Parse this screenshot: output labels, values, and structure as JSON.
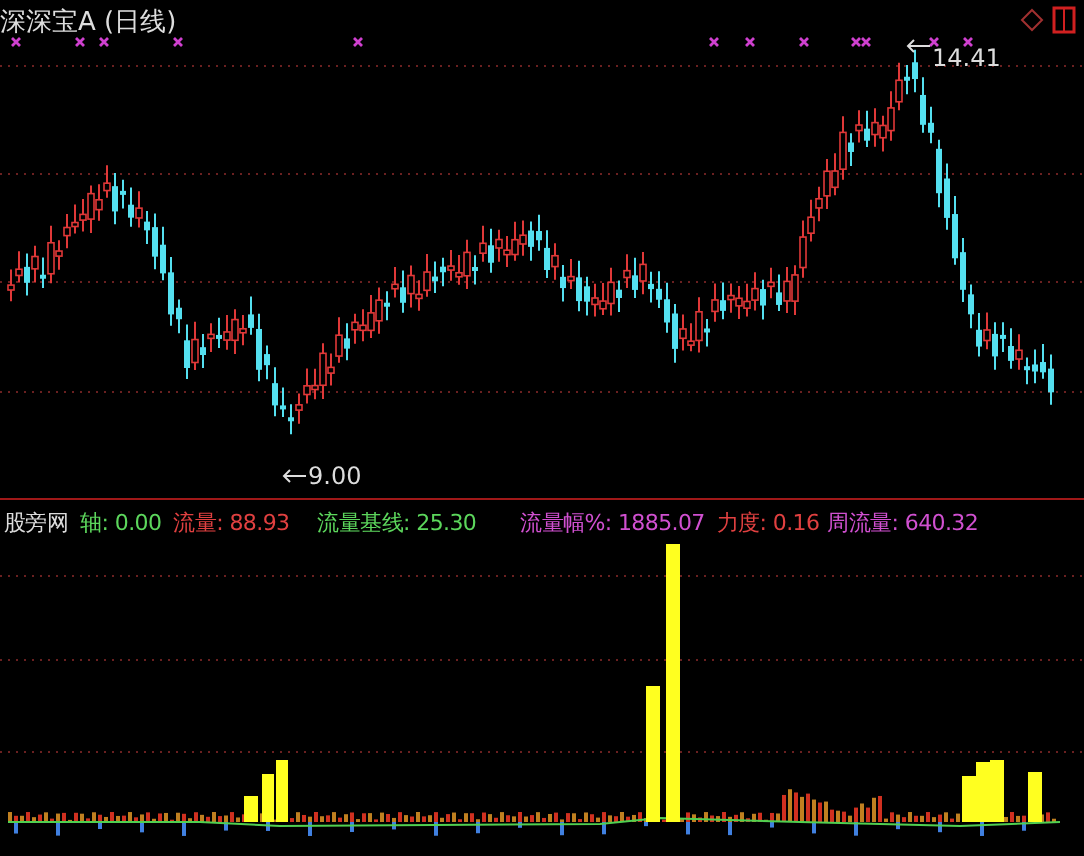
{
  "chart_title": "深深宝A (日线)",
  "price_marks": [
    {
      "kind": "high",
      "text": "14.41"
    },
    {
      "kind": "low",
      "text": "9.00"
    }
  ],
  "indicator": {
    "name": "股旁网",
    "items": [
      {
        "label": "轴:",
        "value": "0.00",
        "color": "#5cd65c"
      },
      {
        "label": "流量:",
        "value": "88.93",
        "color": "#e04040"
      },
      {
        "label": "流量基线:",
        "value": "25.30",
        "color": "#5cd65c"
      },
      {
        "label": "流量幅%:",
        "value": "1885.07",
        "color": "#d050d0"
      },
      {
        "label": "力度:",
        "value": "0.16",
        "color": "#e04040"
      },
      {
        "label": "周流量:",
        "value": "640.32",
        "color": "#d050d0"
      }
    ]
  }
}
